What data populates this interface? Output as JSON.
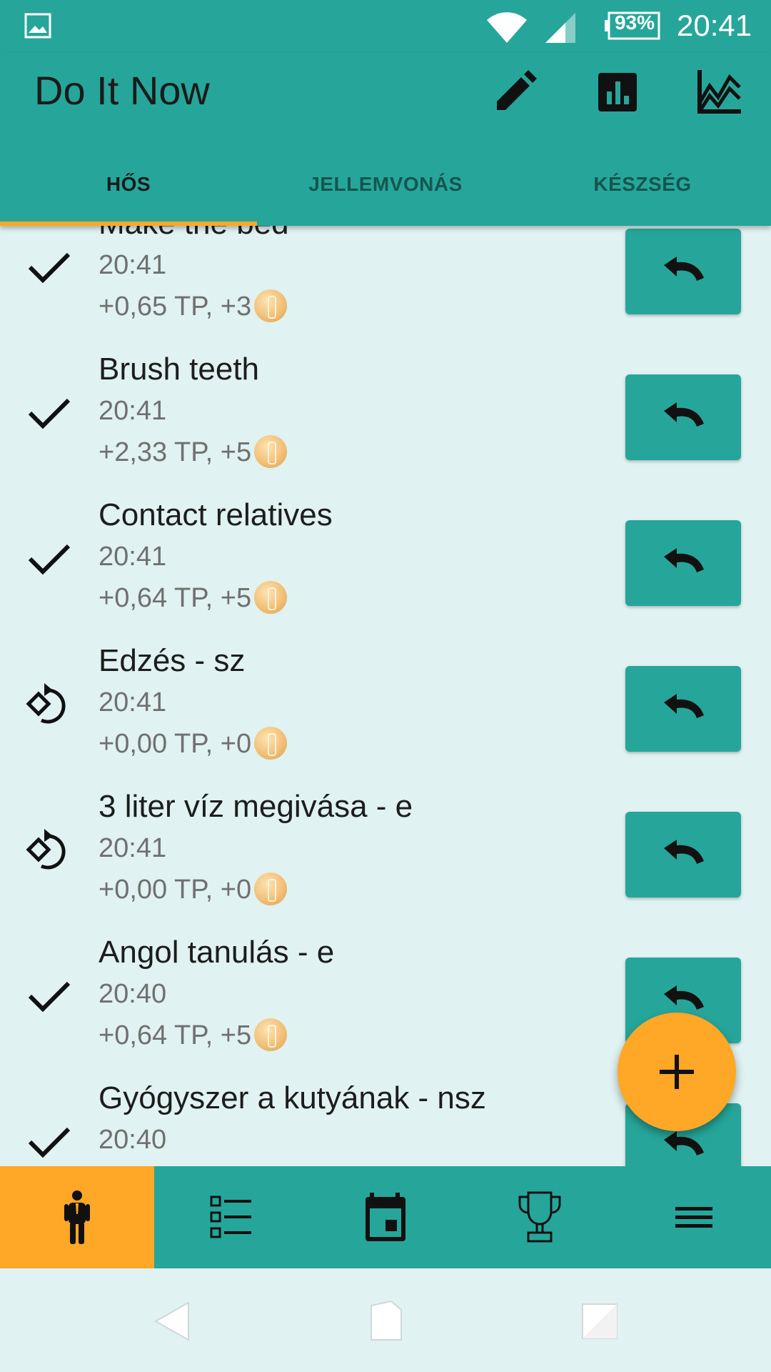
{
  "status_bar": {
    "battery": "93%",
    "time": "20:41",
    "icons": [
      "gallery-icon",
      "wifi-icon",
      "signal-icon",
      "battery-icon"
    ]
  },
  "app_bar": {
    "title": "Do It Now",
    "actions": [
      "edit-icon",
      "bar-chart-icon",
      "line-chart-icon"
    ]
  },
  "tabs": [
    {
      "label": "HŐS",
      "active": true
    },
    {
      "label": "JELLEMVONÁS",
      "active": false
    },
    {
      "label": "KÉSZSÉG",
      "active": false
    }
  ],
  "list": {
    "items": [
      {
        "title": "Make the bed",
        "time": "20:41",
        "reward": "+0,65 TP, +3",
        "status_icon": "check-icon"
      },
      {
        "title": "Brush teeth",
        "time": "20:41",
        "reward": "+2,33 TP, +5",
        "status_icon": "check-icon"
      },
      {
        "title": "Contact relatives",
        "time": "20:41",
        "reward": "+0,64 TP, +5",
        "status_icon": "check-icon"
      },
      {
        "title": "Edzés - sz",
        "time": "20:41",
        "reward": "+0,00 TP, +0",
        "status_icon": "skip-icon"
      },
      {
        "title": "3 liter víz megivása - e",
        "time": "20:41",
        "reward": "+0,00 TP, +0",
        "status_icon": "skip-icon"
      },
      {
        "title": "Angol tanulás - e",
        "time": "20:40",
        "reward": "+0,64 TP, +5",
        "status_icon": "check-icon"
      },
      {
        "title": "Gyógyszer a kutyának - nsz",
        "time": "20:40",
        "reward": "",
        "status_icon": "check-icon"
      }
    ],
    "undo_icon": "undo-icon",
    "coin_icon": "coin-icon"
  },
  "fab": {
    "icon": "plus-icon"
  },
  "bottom_nav": [
    {
      "icon": "hero-icon",
      "active": true
    },
    {
      "icon": "checklist-icon",
      "active": false
    },
    {
      "icon": "calendar-icon",
      "active": false
    },
    {
      "icon": "trophy-icon",
      "active": false
    },
    {
      "icon": "menu-icon",
      "active": false
    }
  ],
  "system_nav": [
    "back-icon",
    "home-icon",
    "recents-icon"
  ],
  "colors": {
    "primary": "#26a69a",
    "accent": "#ffa726",
    "background": "#e0f2f1",
    "title_text": "#1d1d1d",
    "secondary_text": "#707070"
  }
}
